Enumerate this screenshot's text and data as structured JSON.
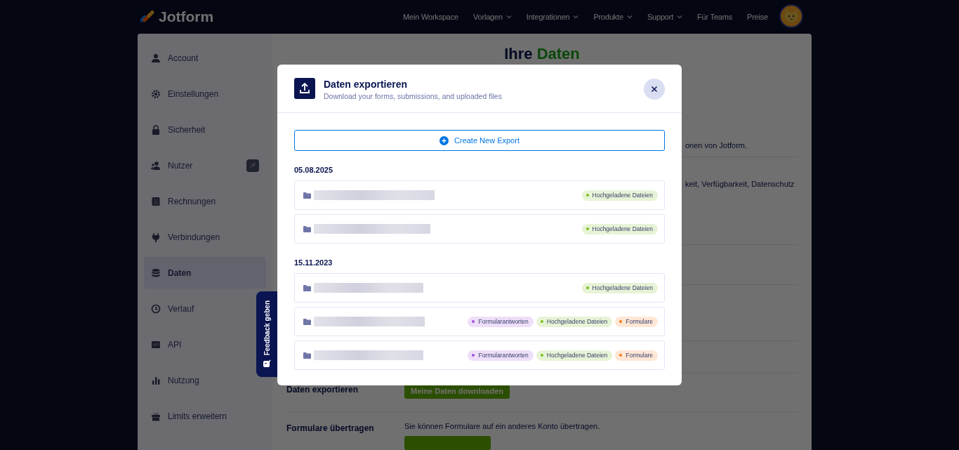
{
  "nav": {
    "logo": "Jotform",
    "links": [
      {
        "label": "Mein Workspace",
        "dropdown": false
      },
      {
        "label": "Vorlagen",
        "dropdown": true
      },
      {
        "label": "Integrationen",
        "dropdown": true
      },
      {
        "label": "Produkte",
        "dropdown": true
      },
      {
        "label": "Support",
        "dropdown": true
      },
      {
        "label": "Für Teams",
        "dropdown": false
      },
      {
        "label": "Preise",
        "dropdown": false
      }
    ]
  },
  "sidebar": {
    "items": [
      {
        "label": "Account",
        "selected": false
      },
      {
        "label": "Einstellungen",
        "selected": false
      },
      {
        "label": "Sicherheit",
        "selected": false
      },
      {
        "label": "Nutzer",
        "selected": false
      },
      {
        "label": "Rechnungen",
        "selected": false
      },
      {
        "label": "Verbindungen",
        "selected": false
      },
      {
        "label": "Daten",
        "selected": true
      },
      {
        "label": "Verlauf",
        "selected": false
      },
      {
        "label": "API",
        "selected": false
      },
      {
        "label": "Nutzung",
        "selected": false
      },
      {
        "label": "Limits erweitern",
        "selected": false
      }
    ]
  },
  "main": {
    "heading": {
      "text": "Ihre",
      "highlight": "Daten"
    },
    "sections": [
      {
        "kind": "text",
        "description": "onen von Jotform."
      },
      {
        "kind": "text",
        "description": "keit, Verfügbarkeit, Datenschutz"
      },
      {
        "kind": "empty"
      },
      {
        "kind": "empty"
      },
      {
        "kind": "empty"
      },
      {
        "kind": "action",
        "label": "Daten exportieren",
        "button": "Meine Daten downloaden"
      },
      {
        "kind": "action",
        "label": "Formulare übertragen",
        "description": "Sie können Formulare auf ein anderes Konto übertragen."
      }
    ]
  },
  "feedback_tab": {
    "label": "Feedback geben"
  },
  "modal": {
    "title": "Daten exportieren",
    "subtitle": "Download your forms, submissions, and uploaded files",
    "create_button": "Create New Export",
    "groups": [
      {
        "date": "05.08.2025",
        "exports": [
          {
            "tags": [
              {
                "label": "Hochgeladene Dateien",
                "color": "#78bf1a"
              }
            ]
          },
          {
            "tags": [
              {
                "label": "Hochgeladene Dateien",
                "color": "#78bf1a"
              }
            ]
          }
        ]
      },
      {
        "date": "15.11.2023",
        "exports": [
          {
            "tags": [
              {
                "label": "Hochgeladene Dateien",
                "color": "#78bf1a"
              }
            ]
          },
          {
            "tags": [
              {
                "label": "Formularantworten",
                "color": "#a34fe0"
              },
              {
                "label": "Hochgeladene Dateien",
                "color": "#78bf1a"
              },
              {
                "label": "Formulare",
                "color": "#ff7a1a"
              }
            ]
          },
          {
            "tags": [
              {
                "label": "Formularantworten",
                "color": "#a34fe0"
              },
              {
                "label": "Hochgeladene Dateien",
                "color": "#78bf1a"
              },
              {
                "label": "Formulare",
                "color": "#ff7a1a"
              }
            ]
          }
        ]
      }
    ]
  }
}
